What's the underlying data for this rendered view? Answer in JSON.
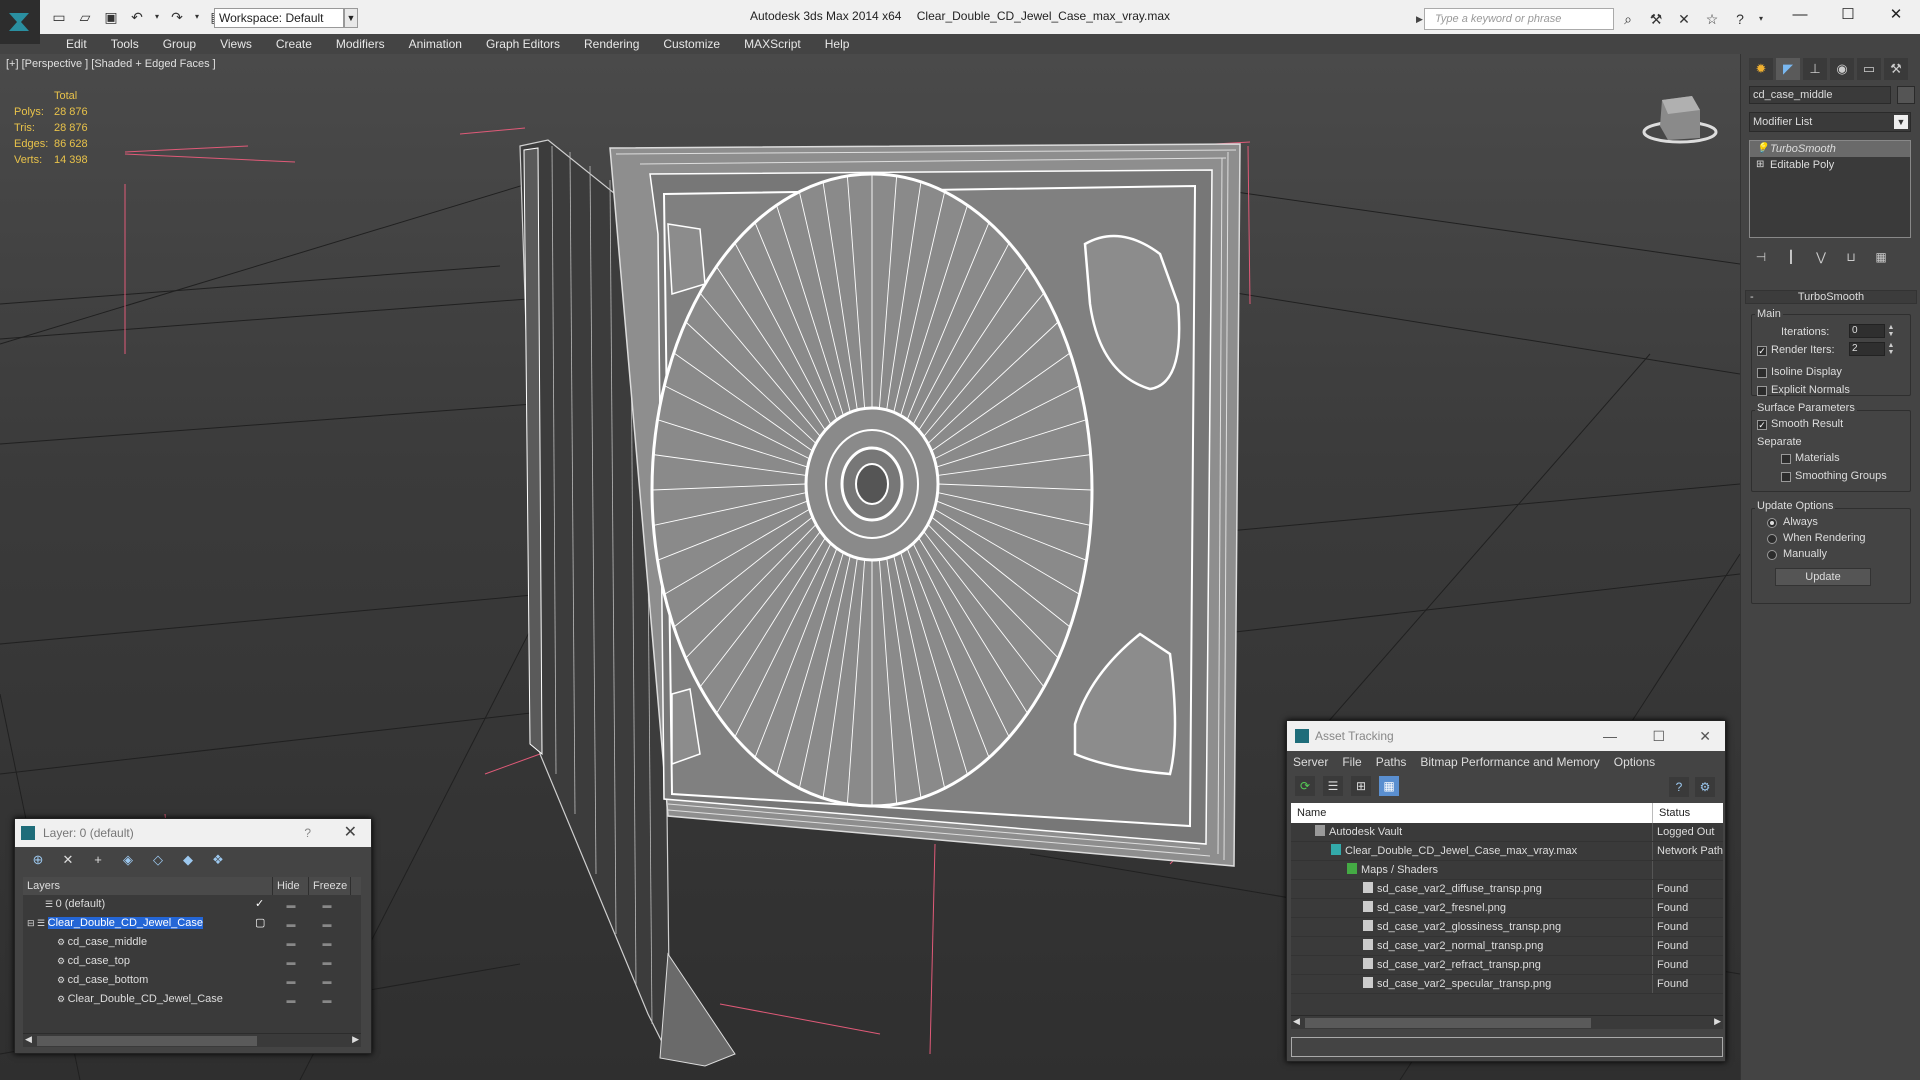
{
  "titlebar": {
    "app_title": "Autodesk 3ds Max  2014 x64",
    "file_name": "Clear_Double_CD_Jewel_Case_max_vray.max",
    "workspace": "Workspace: Default",
    "search_placeholder": "Type a keyword or phrase"
  },
  "menubar": [
    "Edit",
    "Tools",
    "Group",
    "Views",
    "Create",
    "Modifiers",
    "Animation",
    "Graph Editors",
    "Rendering",
    "Customize",
    "MAXScript",
    "Help"
  ],
  "viewport": {
    "label": "[+] [Perspective ] [Shaded + Edged Faces ]",
    "stats": {
      "header": "Total",
      "rows": [
        {
          "key": "Polys:",
          "value": "28 876"
        },
        {
          "key": "Tris:",
          "value": "28 876"
        },
        {
          "key": "Edges:",
          "value": "86 628"
        },
        {
          "key": "Verts:",
          "value": "14 398"
        }
      ]
    }
  },
  "command_panel": {
    "object_name": "cd_case_middle",
    "modifier_list": "Modifier List",
    "stack": [
      "TurboSmooth",
      "Editable Poly"
    ],
    "rollout_title": "TurboSmooth",
    "main_group": "Main",
    "iterations_label": "Iterations:",
    "iterations_value": "0",
    "render_iters_label": "Render Iters:",
    "render_iters_value": "2",
    "isoline": "Isoline Display",
    "explicit_normals": "Explicit Normals",
    "surface_group": "Surface Parameters",
    "smooth_result": "Smooth Result",
    "separate_label": "Separate",
    "materials": "Materials",
    "smoothing_groups": "Smoothing Groups",
    "update_group": "Update Options",
    "always": "Always",
    "when_rendering": "When Rendering",
    "manually": "Manually",
    "update_button": "Update"
  },
  "layer_panel": {
    "title": "Layer: 0 (default)",
    "help": "?",
    "columns": [
      "Layers",
      "Hide",
      "Freeze"
    ],
    "rows": [
      {
        "name": "0 (default)"
      },
      {
        "name": "Clear_Double_CD_Jewel_Case"
      },
      {
        "name": "cd_case_middle"
      },
      {
        "name": "cd_case_top"
      },
      {
        "name": "cd_case_bottom"
      },
      {
        "name": "Clear_Double_CD_Jewel_Case"
      }
    ]
  },
  "asset_panel": {
    "title": "Asset Tracking",
    "menu": [
      "Server",
      "File",
      "Paths",
      "Bitmap Performance and Memory",
      "Options"
    ],
    "columns": [
      "Name",
      "Status"
    ],
    "rows": [
      {
        "name": "Autodesk Vault",
        "status": "Logged Out"
      },
      {
        "name": "Clear_Double_CD_Jewel_Case_max_vray.max",
        "status": "Network Path"
      },
      {
        "name": "Maps / Shaders",
        "status": ""
      },
      {
        "name": "sd_case_var2_diffuse_transp.png",
        "status": "Found"
      },
      {
        "name": "sd_case_var2_fresnel.png",
        "status": "Found"
      },
      {
        "name": "sd_case_var2_glossiness_transp.png",
        "status": "Found"
      },
      {
        "name": "sd_case_var2_normal_transp.png",
        "status": "Found"
      },
      {
        "name": "sd_case_var2_refract_transp.png",
        "status": "Found"
      },
      {
        "name": "sd_case_var2_specular_transp.png",
        "status": "Found"
      }
    ]
  },
  "colors": {
    "accent": "#2466d6",
    "stats": "#e8c24a",
    "wire": "#ffffff",
    "selection_bracket": "#e05a78"
  }
}
